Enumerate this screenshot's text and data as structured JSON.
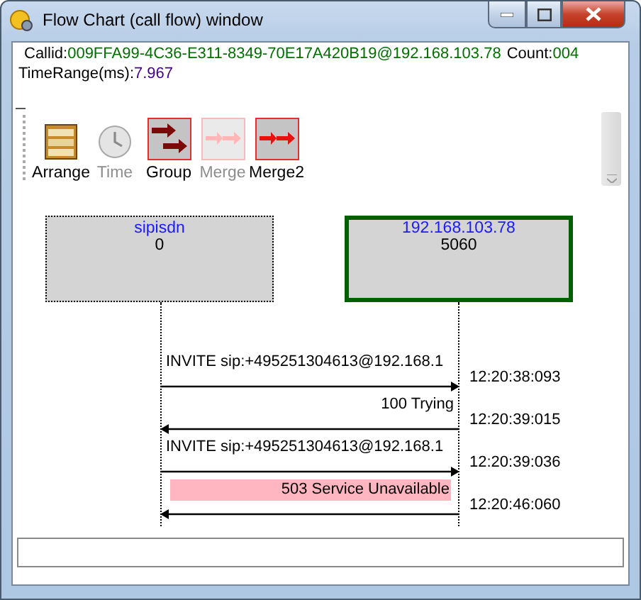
{
  "window": {
    "title": "Flow Chart (call flow) window"
  },
  "call": {
    "callid_label": "Callid:",
    "callid": "009FFA99-4C36-E311-8349-70E17A420B19@192.168.103.78",
    "count_label": "Count:",
    "count": "004",
    "time_range_label": "TimeRange(ms):",
    "time_range": "7.967"
  },
  "toolbar": [
    {
      "label": "Arrange",
      "kind": "arrange",
      "disabled": false
    },
    {
      "label": "Time",
      "kind": "clock",
      "disabled": true
    },
    {
      "label": "Group",
      "kind": "group",
      "disabled": false
    },
    {
      "label": "Merge",
      "kind": "merge",
      "disabled": true
    },
    {
      "label": "Merge2",
      "kind": "merge",
      "disabled": false
    }
  ],
  "nodes": [
    {
      "name": "sipisdn",
      "port": "0",
      "selected": false
    },
    {
      "name": "192.168.103.78",
      "port": "5060",
      "selected": true
    }
  ],
  "messages": [
    {
      "label": "INVITE sip:+495251304613@192.168.1",
      "time": "12:20:38:093",
      "kind": "request",
      "highlighted": false
    },
    {
      "label": "100 Trying",
      "time": "12:20:39:015",
      "kind": "response",
      "highlighted": false
    },
    {
      "label": "INVITE sip:+495251304613@192.168.1",
      "time": "12:20:39:036",
      "kind": "request",
      "highlighted": false
    },
    {
      "label": "503 Service Unavailable",
      "time": "12:20:46:060",
      "kind": "response",
      "highlighted": true
    }
  ]
}
